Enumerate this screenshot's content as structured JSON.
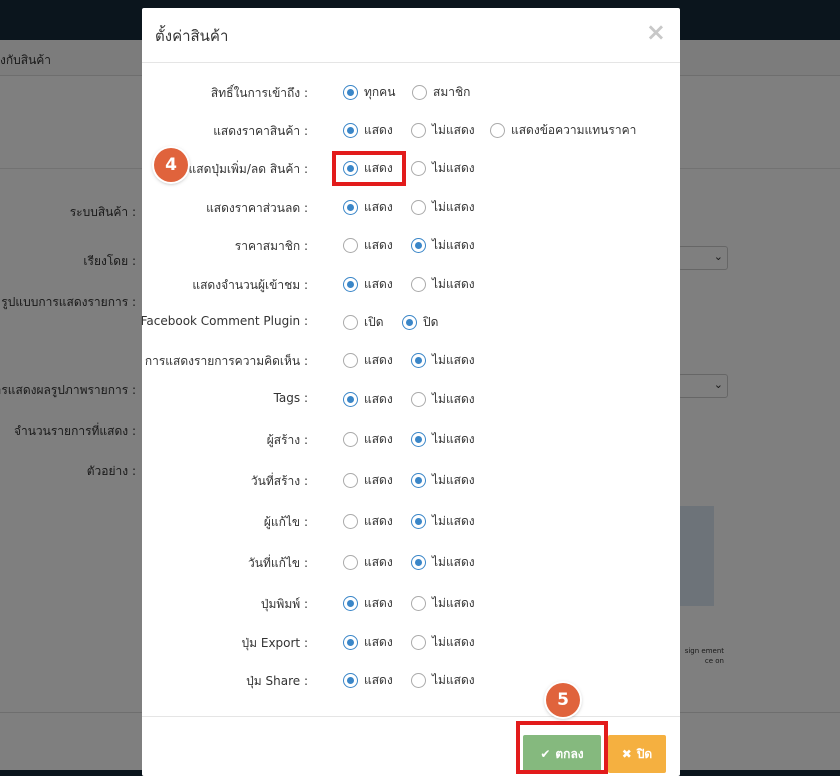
{
  "background": {
    "breadcrumb": "งกับสินค้า",
    "labels": [
      "ระบบสินค้า :",
      "เรียงโดย :",
      "รูปแบบการแสดงรายการ :",
      "การแสดงผลรูปภาพรายการ :",
      "จำนวนรายการที่แสดง :",
      "ตัวอย่าง :"
    ],
    "preview_text": "sign ement ce on"
  },
  "modal": {
    "title": "ตั้งค่าสินค้า",
    "close_glyph": "×",
    "rows": [
      {
        "label": "สิทธิ์ในการเข้าถึง :",
        "options": [
          {
            "text": "ทุกคน",
            "checked": true
          },
          {
            "text": "สมาชิก",
            "checked": false
          }
        ]
      },
      {
        "label": "แสดงราคาสินค้า :",
        "options": [
          {
            "text": "แสดง",
            "checked": true
          },
          {
            "text": "ไม่แสดง",
            "checked": false
          },
          {
            "text": "แสดงข้อความแทนราคา",
            "checked": false
          }
        ]
      },
      {
        "label": "แสดปุ่มเพิ่ม/ลด สินค้า :",
        "options": [
          {
            "text": "แสดง",
            "checked": true
          },
          {
            "text": "ไม่แสดง",
            "checked": false
          }
        ]
      },
      {
        "label": "แสดงราคาส่วนลด :",
        "options": [
          {
            "text": "แสดง",
            "checked": true
          },
          {
            "text": "ไม่แสดง",
            "checked": false
          }
        ]
      },
      {
        "label": "ราคาสมาชิก :",
        "options": [
          {
            "text": "แสดง",
            "checked": false
          },
          {
            "text": "ไม่แสดง",
            "checked": true
          }
        ]
      },
      {
        "label": "แสดงจำนวนผู้เข้าชม :",
        "options": [
          {
            "text": "แสดง",
            "checked": true
          },
          {
            "text": "ไม่แสดง",
            "checked": false
          }
        ]
      },
      {
        "label": "Facebook Comment Plugin :",
        "options": [
          {
            "text": "เปิด",
            "checked": false
          },
          {
            "text": "ปิด",
            "checked": true
          }
        ]
      },
      {
        "label": "การแสดงรายการความคิดเห็น :",
        "options": [
          {
            "text": "แสดง",
            "checked": false
          },
          {
            "text": "ไม่แสดง",
            "checked": true
          }
        ]
      },
      {
        "label": "Tags :",
        "options": [
          {
            "text": "แสดง",
            "checked": true
          },
          {
            "text": "ไม่แสดง",
            "checked": false
          }
        ]
      },
      {
        "label": "ผู้สร้าง :",
        "options": [
          {
            "text": "แสดง",
            "checked": false
          },
          {
            "text": "ไม่แสดง",
            "checked": true
          }
        ]
      },
      {
        "label": "วันที่สร้าง :",
        "options": [
          {
            "text": "แสดง",
            "checked": false
          },
          {
            "text": "ไม่แสดง",
            "checked": true
          }
        ]
      },
      {
        "label": "ผู้แก้ไข :",
        "options": [
          {
            "text": "แสดง",
            "checked": false
          },
          {
            "text": "ไม่แสดง",
            "checked": true
          }
        ]
      },
      {
        "label": "วันที่แก้ไข :",
        "options": [
          {
            "text": "แสดง",
            "checked": false
          },
          {
            "text": "ไม่แสดง",
            "checked": true
          }
        ]
      },
      {
        "label": "ปุ่มพิมพ์ :",
        "options": [
          {
            "text": "แสดง",
            "checked": true
          },
          {
            "text": "ไม่แสดง",
            "checked": false
          }
        ]
      },
      {
        "label": "ปุ่ม Export :",
        "options": [
          {
            "text": "แสดง",
            "checked": true
          },
          {
            "text": "ไม่แสดง",
            "checked": false
          }
        ]
      },
      {
        "label": "ปุ่ม Share :",
        "options": [
          {
            "text": "แสดง",
            "checked": true
          },
          {
            "text": "ไม่แสดง",
            "checked": false
          }
        ]
      }
    ],
    "buttons": {
      "ok_icon": "✔",
      "ok_label": "ตกลง",
      "close_icon": "✖",
      "close_label": "ปิด"
    }
  },
  "annotations": {
    "step_4": "4",
    "step_5": "5"
  },
  "colors": {
    "accent_radio": "#3a86c8",
    "ok_button": "#85b97e",
    "close_button": "#f5b040",
    "highlight": "#e21b1b",
    "badge": "#e0633c"
  }
}
